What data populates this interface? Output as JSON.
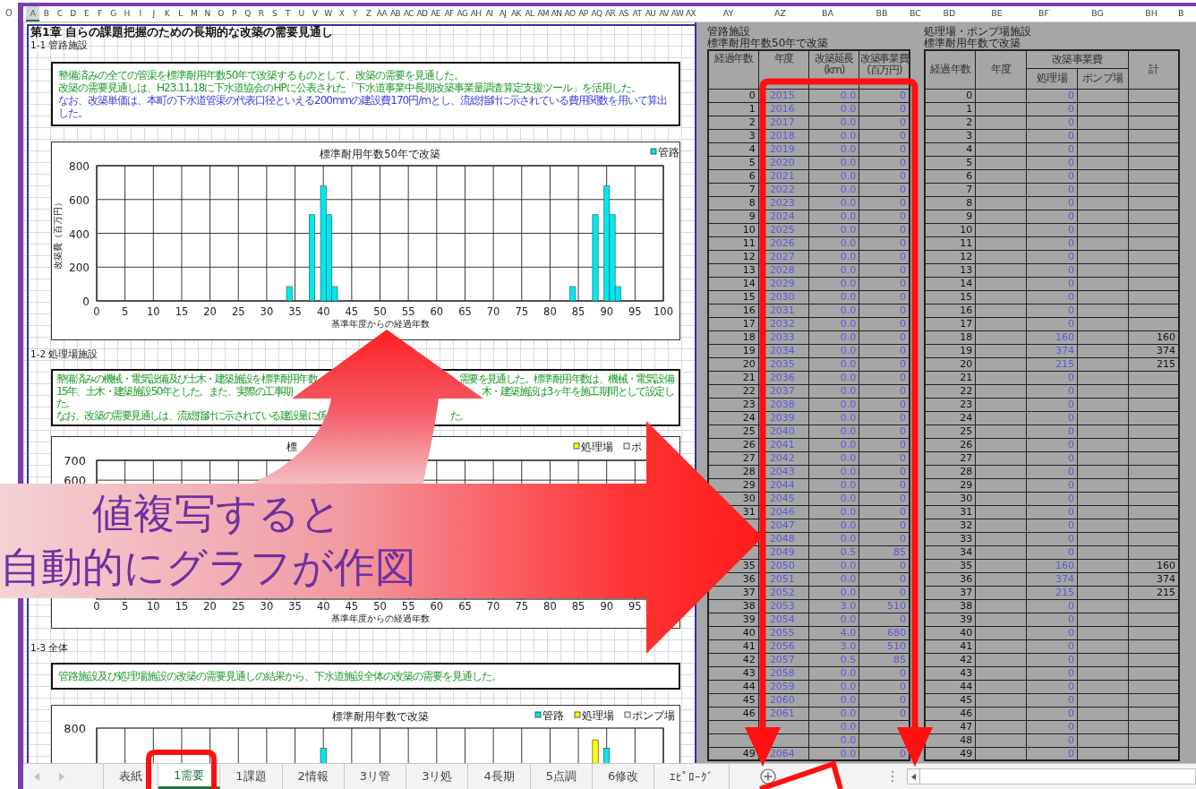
{
  "side_pane": {
    "column_header": "O"
  },
  "column_headers": {
    "left": [
      {
        "label": "A",
        "selected": true
      },
      {
        "label": "B",
        "selected": false
      },
      {
        "label": "C",
        "selected": false
      },
      {
        "label": "D",
        "selected": false
      },
      {
        "label": "E",
        "selected": false
      },
      {
        "label": "F",
        "selected": false
      },
      {
        "label": "G",
        "selected": false
      },
      {
        "label": "H",
        "selected": false
      },
      {
        "label": "I",
        "selected": false
      },
      {
        "label": "J",
        "selected": false
      },
      {
        "label": "K",
        "selected": false
      },
      {
        "label": "L",
        "selected": false
      },
      {
        "label": "M",
        "selected": false
      },
      {
        "label": "N",
        "selected": false
      },
      {
        "label": "O",
        "selected": false
      },
      {
        "label": "P",
        "selected": false
      },
      {
        "label": "Q",
        "selected": false
      },
      {
        "label": "R",
        "selected": false
      },
      {
        "label": "S",
        "selected": false
      },
      {
        "label": "T",
        "selected": false
      },
      {
        "label": "U",
        "selected": false
      },
      {
        "label": "V",
        "selected": false
      },
      {
        "label": "W",
        "selected": false
      },
      {
        "label": "X",
        "selected": false
      },
      {
        "label": "Y",
        "selected": false
      },
      {
        "label": "Z",
        "selected": false
      },
      {
        "label": "AA",
        "selected": false
      },
      {
        "label": "AB",
        "selected": false
      },
      {
        "label": "AC",
        "selected": false
      },
      {
        "label": "AD",
        "selected": false
      },
      {
        "label": "AE",
        "selected": false
      },
      {
        "label": "AF",
        "selected": false
      },
      {
        "label": "AG",
        "selected": false
      },
      {
        "label": "AH",
        "selected": false
      },
      {
        "label": "AI",
        "selected": false
      },
      {
        "label": "AJ",
        "selected": false
      },
      {
        "label": "AK",
        "selected": false
      },
      {
        "label": "AL",
        "selected": false
      },
      {
        "label": "AM",
        "selected": false
      },
      {
        "label": "AN",
        "selected": false
      },
      {
        "label": "AO",
        "selected": false
      },
      {
        "label": "AP",
        "selected": false
      },
      {
        "label": "AQ",
        "selected": false
      },
      {
        "label": "AR",
        "selected": false
      },
      {
        "label": "AS",
        "selected": false
      },
      {
        "label": "AT",
        "selected": false
      },
      {
        "label": "AU",
        "selected": false
      },
      {
        "label": "AV",
        "selected": false
      },
      {
        "label": "AW",
        "selected": false
      },
      {
        "label": "AX",
        "selected": false
      }
    ],
    "right": [
      {
        "label": "AY",
        "selected": false
      },
      {
        "label": "AZ",
        "selected": false
      },
      {
        "label": "BA",
        "selected": false
      },
      {
        "label": "BB",
        "selected": false
      },
      {
        "label": "BC",
        "selected": false
      },
      {
        "label": "BD",
        "selected": false
      },
      {
        "label": "BE",
        "selected": false
      },
      {
        "label": "BF",
        "selected": false
      },
      {
        "label": "BG",
        "selected": false
      },
      {
        "label": "BH",
        "selected": false
      },
      {
        "label": "B",
        "selected": false
      }
    ]
  },
  "document": {
    "title": "第1章 自らの課題把握のための長期的な改築の需要見通し",
    "sections": [
      {
        "heading": "1-1 管路施設",
        "note": {
          "lines": [
            {
              "kind": "whole",
              "color": "#1f9a2a",
              "text": "整備済みの全ての管渠を標準耐用年数50年で改築するものとして、改築の需要を見通した。"
            },
            {
              "kind": "whole",
              "color": "#1f9a2a",
              "text": "改築の需要見通しは、H23.11.18に下水道協会のHPに公表された「下水道事業中長期改築事業量調査算定支援ツール」を活用した。"
            },
            {
              "kind": "whole",
              "color": "#3a3ae0",
              "text": "なお、改築単価は、本町の下水道管渠の代表口径といえる200mmの建設費170円/mとし、流総指針に示されている費用関数を用いて算出した。"
            }
          ]
        },
        "chart": {
          "kind": "bar_chart",
          "chart_data": {
            "type": "bar",
            "title": "標準耐用年数50年で改築",
            "xlabel": "基準年度からの経過年数",
            "ylabel": "改築費（百万円）",
            "x": [
              34,
              38,
              40,
              41,
              42,
              84,
              88,
              90,
              91,
              92
            ],
            "series": [
              {
                "name": "管路",
                "color": "#00e8ee",
                "values": [
                  85,
                  510,
                  680,
                  510,
                  85,
                  85,
                  510,
                  680,
                  510,
                  85
                ]
              }
            ],
            "xlim": [
              0,
              100
            ],
            "ylim": [
              0,
              800
            ],
            "xticks": [
              0,
              5,
              10,
              15,
              20,
              25,
              30,
              35,
              40,
              45,
              50,
              55,
              60,
              65,
              70,
              75,
              80,
              85,
              90,
              95,
              100
            ],
            "yticks": [
              0,
              200,
              400,
              600,
              800
            ],
            "grid": true
          }
        }
      },
      {
        "heading": "1-2 処理場施設",
        "note": {
          "color": "#1f9a2a",
          "lines": [
            {
              "kind": "edge",
              "fragments": [
                "整備済みの機械・電気設備及び土木・建築施設を標準耐用年数",
                "需要を見通した。標準耐用年数は、機械・電気設備"
              ]
            },
            {
              "kind": "edge",
              "fragments": [
                "15年、土木・建築施設50年とした。また、実際の工事期",
                "木・建築施設は3ヶ年を施工期間として設定し"
              ]
            },
            {
              "kind": "whole",
              "text": "た。"
            },
            {
              "kind": "gap",
              "fragments": [
                "なお、改築の需要見通しは、流総指針に示されている建設量に係",
                "た。"
              ]
            }
          ]
        },
        "chart": {
          "kind": "covered",
          "title": "標",
          "legend": [
            {
              "label": "処理場",
              "color": "#ffff00"
            },
            {
              "label": "ポ",
              "color": "#f2f2f2"
            }
          ],
          "ytick_labels": [
            "700",
            "600"
          ],
          "xtick_labels": [
            "0",
            "5",
            "10",
            "15",
            "20",
            "25",
            "30",
            "35",
            "40",
            "45",
            "50",
            "55",
            "60",
            "65",
            "70",
            "75",
            "80",
            "85",
            "90",
            "95"
          ],
          "xlabel": "基準年度からの経過年数"
        }
      },
      {
        "heading": "1-3 全体",
        "note": {
          "lines": [
            {
              "kind": "whole",
              "color": "#1f9a2a",
              "text": "管路施設及び処理場施設の改築の需要見通しの結果から、下水道施設全体の改築の需要を見通した。"
            }
          ]
        },
        "chart": {
          "kind": "preview",
          "title": "標準耐用年数で改築",
          "legend": [
            {
              "label": "管路",
              "color": "#00e8ee"
            },
            {
              "label": "処理場",
              "color": "#ffff00"
            },
            {
              "label": "ポンプ場",
              "color": "#f2f2f2"
            }
          ],
          "ytick_labels": [
            "800"
          ]
        }
      }
    ]
  },
  "pipe_table": {
    "title": "管路施設",
    "subtitle": "標準耐用年数50年で改築",
    "columns": [
      "経過年数",
      "年度",
      "改築延長\n(km)",
      "改築事業費\n(百万円)"
    ],
    "rows": [
      {
        "elapsed": "0",
        "year": "2015",
        "length": "0.0",
        "cost": "0"
      },
      {
        "elapsed": "1",
        "year": "2016",
        "length": "0.0",
        "cost": "0"
      },
      {
        "elapsed": "2",
        "year": "2017",
        "length": "0.0",
        "cost": "0"
      },
      {
        "elapsed": "3",
        "year": "2018",
        "length": "0.0",
        "cost": "0"
      },
      {
        "elapsed": "4",
        "year": "2019",
        "length": "0.0",
        "cost": "0"
      },
      {
        "elapsed": "5",
        "year": "2020",
        "length": "0.0",
        "cost": "0"
      },
      {
        "elapsed": "6",
        "year": "2021",
        "length": "0.0",
        "cost": "0"
      },
      {
        "elapsed": "7",
        "year": "2022",
        "length": "0.0",
        "cost": "0"
      },
      {
        "elapsed": "8",
        "year": "2023",
        "length": "0.0",
        "cost": "0"
      },
      {
        "elapsed": "9",
        "year": "2024",
        "length": "0.0",
        "cost": "0"
      },
      {
        "elapsed": "10",
        "year": "2025",
        "length": "0.0",
        "cost": "0"
      },
      {
        "elapsed": "11",
        "year": "2026",
        "length": "0.0",
        "cost": "0"
      },
      {
        "elapsed": "12",
        "year": "2027",
        "length": "0.0",
        "cost": "0"
      },
      {
        "elapsed": "13",
        "year": "2028",
        "length": "0.0",
        "cost": "0"
      },
      {
        "elapsed": "14",
        "year": "2029",
        "length": "0.0",
        "cost": "0"
      },
      {
        "elapsed": "15",
        "year": "2030",
        "length": "0.0",
        "cost": "0"
      },
      {
        "elapsed": "16",
        "year": "2031",
        "length": "0.0",
        "cost": "0"
      },
      {
        "elapsed": "17",
        "year": "2032",
        "length": "0.0",
        "cost": "0"
      },
      {
        "elapsed": "18",
        "year": "2033",
        "length": "0.0",
        "cost": "0"
      },
      {
        "elapsed": "19",
        "year": "2034",
        "length": "0.0",
        "cost": "0"
      },
      {
        "elapsed": "20",
        "year": "2035",
        "length": "0.0",
        "cost": "0"
      },
      {
        "elapsed": "21",
        "year": "2036",
        "length": "0.0",
        "cost": "0"
      },
      {
        "elapsed": "22",
        "year": "2037",
        "length": "0.0",
        "cost": "0"
      },
      {
        "elapsed": "23",
        "year": "2038",
        "length": "0.0",
        "cost": "0"
      },
      {
        "elapsed": "24",
        "year": "2039",
        "length": "0.0",
        "cost": "0"
      },
      {
        "elapsed": "25",
        "year": "2040",
        "length": "0.0",
        "cost": "0"
      },
      {
        "elapsed": "26",
        "year": "2041",
        "length": "0.0",
        "cost": "0"
      },
      {
        "elapsed": "27",
        "year": "2042",
        "length": "0.0",
        "cost": "0"
      },
      {
        "elapsed": "28",
        "year": "2043",
        "length": "0.0",
        "cost": "0"
      },
      {
        "elapsed": "29",
        "year": "2044",
        "length": "0.0",
        "cost": "0"
      },
      {
        "elapsed": "30",
        "year": "2045",
        "length": "0.0",
        "cost": "0"
      },
      {
        "elapsed": "31",
        "year": "2046",
        "length": "0.0",
        "cost": "0"
      },
      {
        "year": "2047",
        "length": "0.0",
        "cost": "0"
      },
      {
        "year": "2048",
        "length": "0.0",
        "cost": "0"
      },
      {
        "year": "2049",
        "length": "0.5",
        "cost": "85"
      },
      {
        "elapsed": "35",
        "year": "2050",
        "length": "0.0",
        "cost": "0"
      },
      {
        "elapsed": "36",
        "year": "2051",
        "length": "0.0",
        "cost": "0"
      },
      {
        "elapsed": "37",
        "year": "2052",
        "length": "0.0",
        "cost": "0"
      },
      {
        "elapsed": "38",
        "year": "2053",
        "length": "3.0",
        "cost": "510"
      },
      {
        "elapsed": "39",
        "year": "2054",
        "length": "0.0",
        "cost": "0"
      },
      {
        "elapsed": "40",
        "year": "2055",
        "length": "4.0",
        "cost": "680"
      },
      {
        "elapsed": "41",
        "year": "2056",
        "length": "3.0",
        "cost": "510"
      },
      {
        "elapsed": "42",
        "year": "2057",
        "length": "0.5",
        "cost": "85"
      },
      {
        "elapsed": "43",
        "year": "2058",
        "length": "0.0",
        "cost": "0"
      },
      {
        "elapsed": "44",
        "year": "2059",
        "length": "0.0",
        "cost": "0"
      },
      {
        "elapsed": "45",
        "year": "2060",
        "length": "0.0",
        "cost": "0"
      },
      {
        "elapsed": "46",
        "year": "2061",
        "length": "0.0",
        "cost": "0"
      },
      {
        "length": "0.0"
      },
      {
        "length": "0.0"
      },
      {
        "elapsed": "49",
        "year": "2064",
        "length": "0.0",
        "cost": "0"
      }
    ]
  },
  "plant_table": {
    "title": "処理場・ポンプ場施設",
    "subtitle": "標準耐用年数で改築",
    "group_header": "改築事業費",
    "columns": [
      "経過年数",
      "年度",
      "処理場",
      "ポンプ場",
      "計"
    ],
    "rows": [
      {
        "elapsed": "0",
        "plant": "0"
      },
      {
        "elapsed": "1",
        "plant": "0"
      },
      {
        "elapsed": "2",
        "plant": "0"
      },
      {
        "elapsed": "3",
        "plant": "0"
      },
      {
        "elapsed": "4",
        "plant": "0"
      },
      {
        "elapsed": "5",
        "plant": "0"
      },
      {
        "elapsed": "6",
        "plant": "0"
      },
      {
        "elapsed": "7",
        "plant": "0"
      },
      {
        "elapsed": "8",
        "plant": "0"
      },
      {
        "elapsed": "9",
        "plant": "0"
      },
      {
        "elapsed": "10",
        "plant": "0"
      },
      {
        "elapsed": "11",
        "plant": "0"
      },
      {
        "elapsed": "12",
        "plant": "0"
      },
      {
        "elapsed": "13",
        "plant": "0"
      },
      {
        "elapsed": "14",
        "plant": "0"
      },
      {
        "elapsed": "15",
        "plant": "0"
      },
      {
        "elapsed": "16",
        "plant": "0"
      },
      {
        "elapsed": "17",
        "plant": "0"
      },
      {
        "elapsed": "18",
        "plant": "160",
        "total": "160"
      },
      {
        "elapsed": "19",
        "plant": "374",
        "total": "374"
      },
      {
        "elapsed": "20",
        "plant": "215",
        "total": "215"
      },
      {
        "elapsed": "21",
        "plant": "0"
      },
      {
        "elapsed": "22",
        "plant": "0"
      },
      {
        "elapsed": "23",
        "plant": "0"
      },
      {
        "elapsed": "24",
        "plant": "0"
      },
      {
        "elapsed": "25",
        "plant": "0"
      },
      {
        "elapsed": "26",
        "plant": "0"
      },
      {
        "elapsed": "27",
        "plant": "0"
      },
      {
        "elapsed": "28",
        "plant": "0"
      },
      {
        "elapsed": "29",
        "plant": "0"
      },
      {
        "elapsed": "30",
        "plant": "0"
      },
      {
        "elapsed": "31",
        "plant": "0"
      },
      {
        "elapsed": "32",
        "plant": "0"
      },
      {
        "elapsed": "33",
        "plant": "0"
      },
      {
        "elapsed": "34",
        "plant": "0"
      },
      {
        "elapsed": "35",
        "plant": "160",
        "total": "160"
      },
      {
        "elapsed": "36",
        "plant": "374",
        "total": "374"
      },
      {
        "elapsed": "37",
        "plant": "215",
        "total": "215"
      },
      {
        "elapsed": "38",
        "plant": "0"
      },
      {
        "elapsed": "39",
        "plant": "0"
      },
      {
        "elapsed": "40",
        "plant": "0"
      },
      {
        "elapsed": "41",
        "plant": "0"
      },
      {
        "elapsed": "42",
        "plant": "0"
      },
      {
        "elapsed": "43",
        "plant": "0"
      },
      {
        "elapsed": "44",
        "plant": "0"
      },
      {
        "elapsed": "45",
        "plant": "0"
      },
      {
        "elapsed": "46",
        "plant": "0"
      },
      {
        "elapsed": "47",
        "plant": "0"
      },
      {
        "elapsed": "48",
        "plant": "0"
      },
      {
        "elapsed": "49",
        "plant": "0"
      }
    ]
  },
  "sheet_tabs": [
    {
      "label": "表紙",
      "selected": false
    },
    {
      "label": "1需要",
      "selected": true
    },
    {
      "label": "1課題",
      "selected": false
    },
    {
      "label": "2情報",
      "selected": false
    },
    {
      "label": "3リ管",
      "selected": false
    },
    {
      "label": "3リ処",
      "selected": false
    },
    {
      "label": "4長期",
      "selected": false
    },
    {
      "label": "5点調",
      "selected": false
    },
    {
      "label": "6修改",
      "selected": false
    },
    {
      "label": "ｴﾋﾟﾛｰｸﾞ",
      "selected": false
    }
  ],
  "callout": {
    "lines": [
      "値複写すると",
      "自動的にグラフが作図"
    ]
  }
}
